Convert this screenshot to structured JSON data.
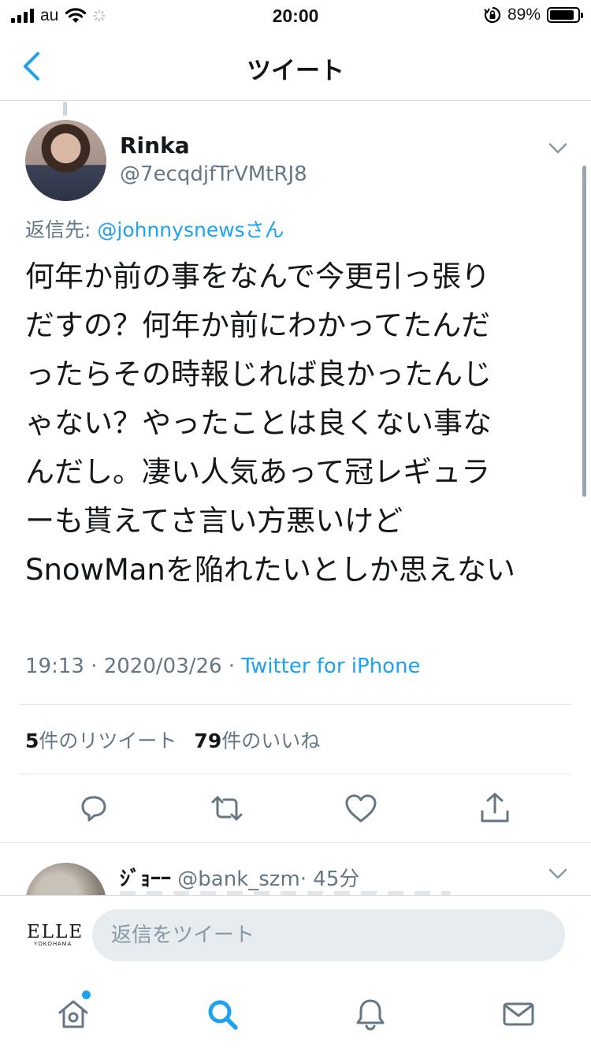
{
  "status_bar": {
    "carrier": "au",
    "time": "20:00",
    "battery_percent": "89%",
    "battery_level": 0.89
  },
  "nav": {
    "title": "ツイート"
  },
  "tweet": {
    "author_name": "Rinka",
    "author_handle": "@7ecqdjfTrVMtRJ8",
    "replying_prefix": "返信先: ",
    "replying_mention": "@johnnysnewsさん",
    "text_lines": [
      "何年か前の事をなんで今更引っ張り",
      "だすの？何年か前にわかってたんだ",
      "ったらその時報じれば良かったんじ",
      "ゃない？やったことは良くない事な",
      "んだし。凄い人気あって冠レギュラ",
      "ーも貰えてさ言い方悪いけど",
      "SnowManを陥れたいとしか思えない"
    ],
    "timestamp": "19:13 · 2020/03/26 · ",
    "app": "Twitter for iPhone",
    "retweet_count": "5",
    "retweet_label": "件のリツイート",
    "like_count": "79",
    "like_label": "件のいいね"
  },
  "reply_preview": {
    "name": "ｼﾞｮｰｰ",
    "handle": "@bank_szm",
    "time": "· 45分"
  },
  "composer": {
    "logo_big": "ELLE",
    "logo_small": "YOKOHAMA",
    "placeholder": "返信をツイート"
  },
  "icons": {
    "actions": [
      "reply-icon",
      "retweet-icon",
      "like-icon",
      "share-icon"
    ],
    "tabs": [
      "home-icon",
      "search-icon",
      "notifications-icon",
      "messages-icon"
    ]
  },
  "colors": {
    "accent": "#1da1f2",
    "secondary_text": "#657786",
    "icon_gray": "#657786"
  }
}
